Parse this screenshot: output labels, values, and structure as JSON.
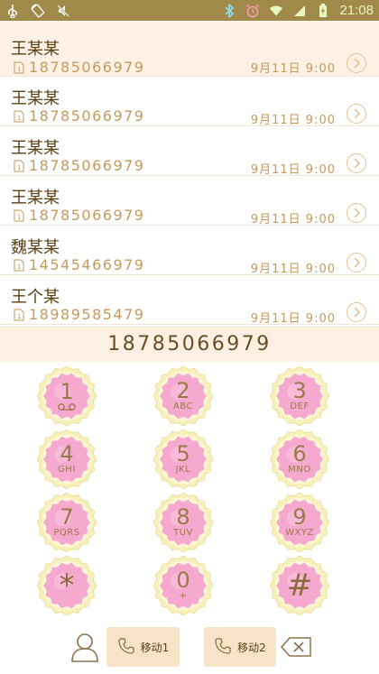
{
  "status_bar": {
    "time": "21:08",
    "icons": [
      "usb-icon",
      "rotate-icon",
      "mute-icon",
      "bluetooth-icon",
      "alarm-icon",
      "wifi-icon",
      "signal-icon",
      "battery-icon"
    ]
  },
  "call_log": [
    {
      "name": "王某某",
      "number": "18785066979",
      "time": "9月11日 9:00"
    },
    {
      "name": "王某某",
      "number": "18785066979",
      "time": "9月11日 9:00"
    },
    {
      "name": "王某某",
      "number": "18785066979",
      "time": "9月11日 9:00"
    },
    {
      "name": "王某某",
      "number": "18785066979",
      "time": "9月11日 9:00"
    },
    {
      "name": "魏某某",
      "number": "14545466979",
      "time": "9月11日 9:00"
    },
    {
      "name": "王个某",
      "number": "18989585479",
      "time": "9月11日 9:00"
    }
  ],
  "dial_display": "18785066979",
  "keypad": [
    {
      "digit": "1",
      "letters": ""
    },
    {
      "digit": "2",
      "letters": "ABC"
    },
    {
      "digit": "3",
      "letters": "DEF"
    },
    {
      "digit": "4",
      "letters": "GHI"
    },
    {
      "digit": "5",
      "letters": "JKL"
    },
    {
      "digit": "6",
      "letters": "MNO"
    },
    {
      "digit": "7",
      "letters": "PQRS"
    },
    {
      "digit": "8",
      "letters": "TUV"
    },
    {
      "digit": "9",
      "letters": "WXYZ"
    },
    {
      "digit": "*",
      "letters": ""
    },
    {
      "digit": "0",
      "letters": "+"
    },
    {
      "digit": "#",
      "letters": ""
    }
  ],
  "bottom_bar": {
    "sim1_label": "移动1",
    "sim2_label": "移动2"
  },
  "colors": {
    "status_bar_bg": "#a08a4a",
    "accent_text": "#c49a5d",
    "name_text": "#5a4016",
    "highlight_bg": "#fcf1e4",
    "key_petal": "#f5a9cf",
    "key_rim": "#f7f0b8"
  }
}
